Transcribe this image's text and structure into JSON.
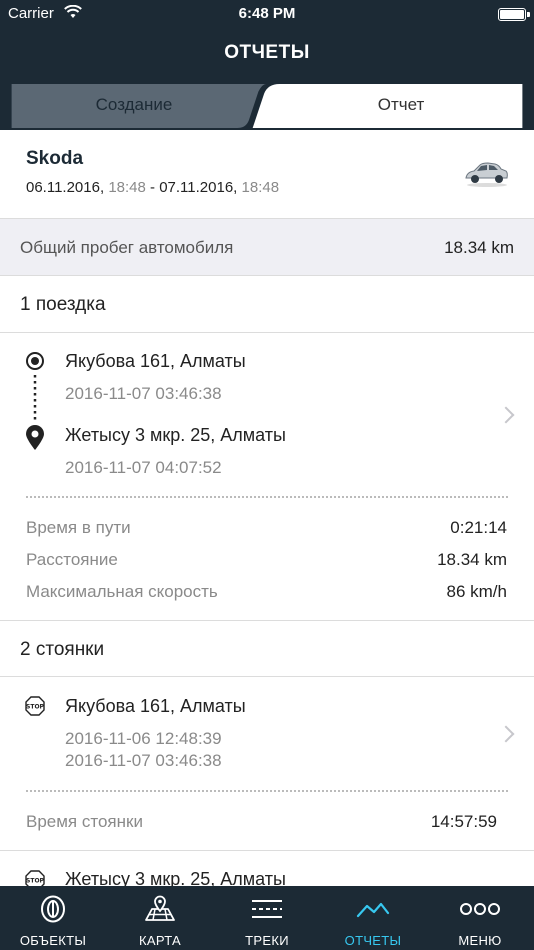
{
  "status_bar": {
    "carrier": "Carrier",
    "time": "6:48 PM"
  },
  "header": {
    "title": "ОТЧЕТЫ"
  },
  "segments": {
    "create": "Создание",
    "report": "Отчет",
    "active": "report"
  },
  "vehicle": {
    "name": "Skoda",
    "from_date": "06.11.2016,",
    "from_time": "18:48",
    "separator": "-",
    "to_date": "07.11.2016,",
    "to_time": "18:48"
  },
  "mileage": {
    "label": "Общий пробег автомобиля",
    "value": "18.34 km"
  },
  "trips": {
    "title": "1 поездка",
    "items": [
      {
        "start_place": "Якубова 161, Алматы",
        "start_time": "2016-11-07 03:46:38",
        "end_place": "Жетысу 3 мкр. 25, Алматы",
        "end_time": "2016-11-07 04:07:52",
        "stats": [
          {
            "label": "Время в пути",
            "value": "0:21:14"
          },
          {
            "label": "Расстояние",
            "value": "18.34 km"
          },
          {
            "label": "Максимальная скорость",
            "value": "86 km/h"
          }
        ]
      }
    ]
  },
  "stops": {
    "title": "2 стоянки",
    "items": [
      {
        "place": "Якубова 161, Алматы",
        "from": "2016-11-06 12:48:39",
        "to": "2016-11-07 03:46:38",
        "duration_label": "Время стоянки",
        "duration": "14:57:59"
      },
      {
        "place": "Жетысу 3 мкр. 25, Алматы"
      }
    ],
    "stop_icon_text": "STOP"
  },
  "tabbar": {
    "items": [
      {
        "label": "ОБЪЕКТЫ",
        "icon": "objects-icon"
      },
      {
        "label": "КАРТА",
        "icon": "map-icon"
      },
      {
        "label": "ТРЕКИ",
        "icon": "tracks-icon"
      },
      {
        "label": "ОТЧЕТЫ",
        "icon": "reports-icon"
      },
      {
        "label": "МЕНЮ",
        "icon": "menu-dots-icon"
      }
    ],
    "active_index": 3
  },
  "colors": {
    "header_bg": "#1c2a35",
    "accent": "#37c8f0",
    "section_bg": "#efeff4",
    "muted_text": "#8a8a8a"
  }
}
